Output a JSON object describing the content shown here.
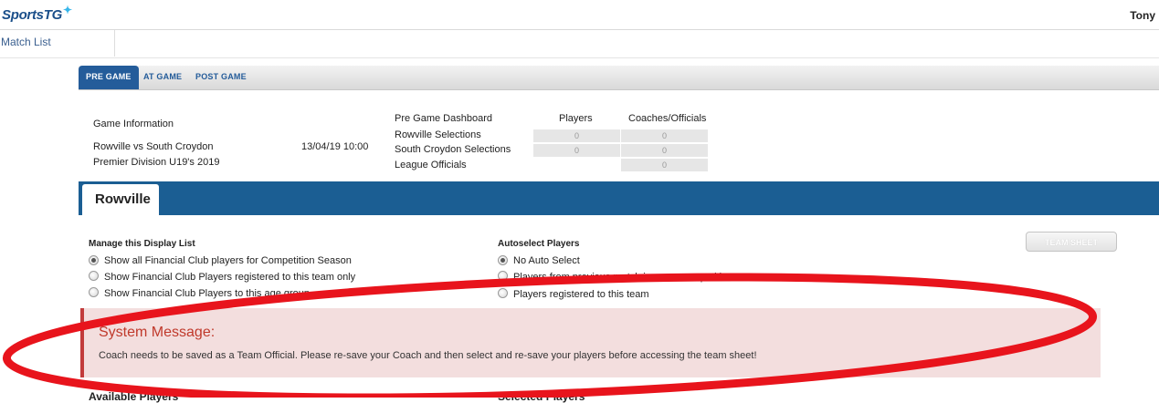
{
  "header": {
    "brand": "SportsTG",
    "brand_star": "✦",
    "user": "Tony"
  },
  "nav": {
    "match_list": "Match List"
  },
  "tabs": [
    {
      "label": "PRE GAME",
      "active": true
    },
    {
      "label": "AT GAME",
      "active": false
    },
    {
      "label": "POST GAME",
      "active": false
    }
  ],
  "game_info": {
    "heading": "Game Information",
    "match": "Rowville vs South Croydon",
    "datetime": "13/04/19 10:00",
    "competition": "Premier Division U19's 2019"
  },
  "dashboard": {
    "heading": "Pre Game Dashboard",
    "col_players": "Players",
    "col_coaches": "Coaches/Officials",
    "rows": [
      {
        "label": "Rowville Selections",
        "players": "0",
        "coaches": "0"
      },
      {
        "label": "South Croydon Selections",
        "players": "0",
        "coaches": "0"
      },
      {
        "label": "League Officials",
        "players": "",
        "coaches": "0"
      }
    ]
  },
  "team_tab": "Rowville",
  "display_list": {
    "heading": "Manage this Display List",
    "options": [
      {
        "label": "Show all Financial Club players for Competition Season",
        "checked": true
      },
      {
        "label": "Show Financial Club Players registered to this team only",
        "checked": false
      },
      {
        "label": "Show Financial Club Players to this age group",
        "checked": false
      }
    ]
  },
  "autoselect": {
    "heading": "Autoselect Players",
    "options": [
      {
        "label": "No Auto Select",
        "checked": true
      },
      {
        "label": "Players from previous match in same competition",
        "checked": false
      },
      {
        "label": "Players registered to this team",
        "checked": false
      }
    ]
  },
  "team_sheet_button": "TEAM SHEET",
  "system_message": {
    "title": "System Message:",
    "body": "Coach needs to be saved as a Team Official. Please re-save your Coach and then select and re-save your players before accessing the team sheet!"
  },
  "bottom": {
    "available": "Available Players",
    "selected": "Selected Players"
  },
  "colors": {
    "brand": "#1b4f8a",
    "band": "#1b5e93",
    "alert_text": "#c0392b",
    "alert_bg": "#f3dede",
    "annotation": "#e8141c"
  }
}
